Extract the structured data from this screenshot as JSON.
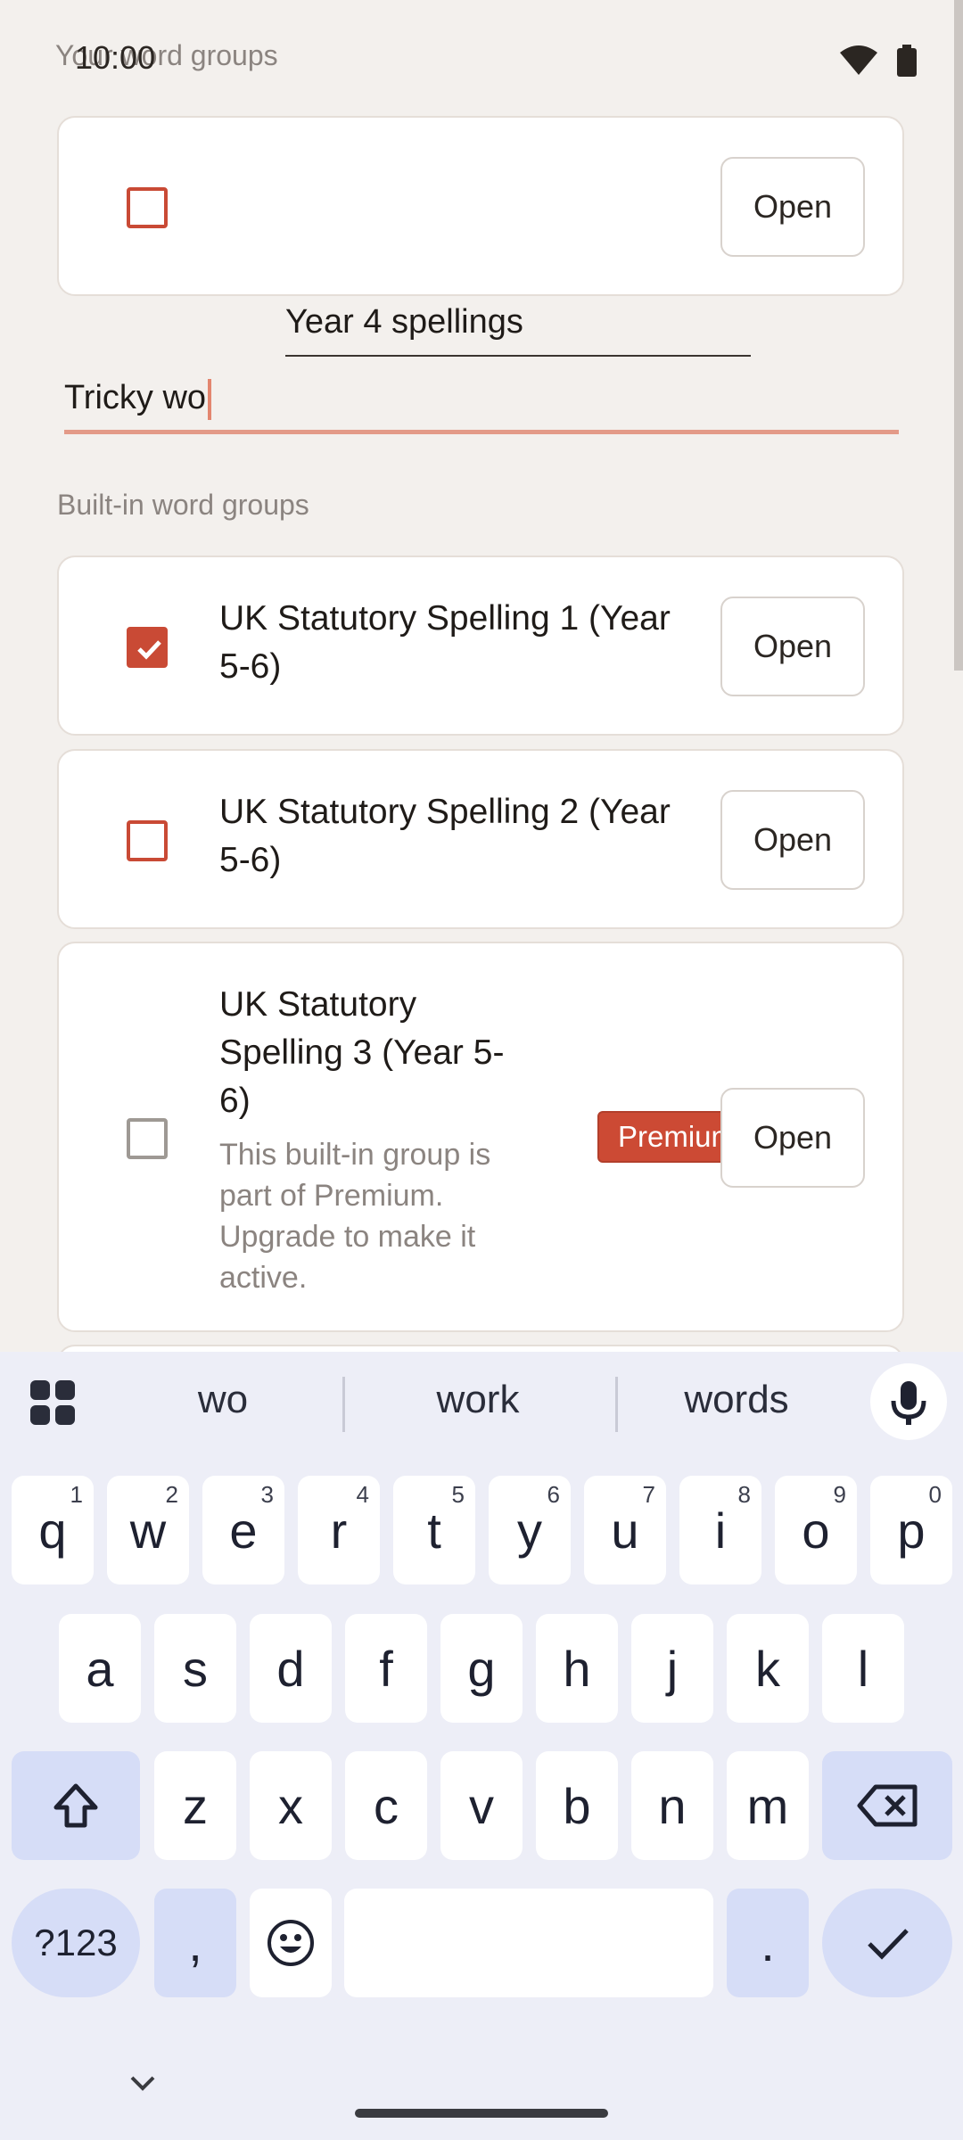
{
  "status_bar": {
    "time": "10:00"
  },
  "sections": {
    "your_groups_label": "Your word groups",
    "builtin_groups_label": "Built-in word groups"
  },
  "user_group": {
    "name": "Year 4 spellings",
    "open_label": "Open",
    "checked": false
  },
  "new_group_input": {
    "value": "Tricky wo"
  },
  "builtin_groups": [
    {
      "title": "UK Statutory Spelling 1 (Year 5-6)",
      "open_label": "Open",
      "checked": true
    },
    {
      "title": "UK Statutory Spelling 2 (Year 5-6)",
      "open_label": "Open",
      "checked": false
    },
    {
      "title": "UK Statutory Spelling 3 (Year 5-6)",
      "description": "This built-in group is part of Premium. Upgrade to make it active.",
      "badge": "Premium",
      "open_label": "Open",
      "checked": false
    }
  ],
  "keyboard": {
    "suggestions": [
      "wo",
      "work",
      "words"
    ],
    "row1": [
      {
        "k": "q",
        "h": "1"
      },
      {
        "k": "w",
        "h": "2"
      },
      {
        "k": "e",
        "h": "3"
      },
      {
        "k": "r",
        "h": "4"
      },
      {
        "k": "t",
        "h": "5"
      },
      {
        "k": "y",
        "h": "6"
      },
      {
        "k": "u",
        "h": "7"
      },
      {
        "k": "i",
        "h": "8"
      },
      {
        "k": "o",
        "h": "9"
      },
      {
        "k": "p",
        "h": "0"
      }
    ],
    "row2": [
      "a",
      "s",
      "d",
      "f",
      "g",
      "h",
      "j",
      "k",
      "l"
    ],
    "row3": [
      "z",
      "x",
      "c",
      "v",
      "b",
      "n",
      "m"
    ],
    "symbols_label": "?123",
    "comma": ",",
    "period": "."
  },
  "colors": {
    "accent": "#c94a35",
    "background": "#f3f0ed",
    "keyboard_bg": "#edeef7"
  }
}
